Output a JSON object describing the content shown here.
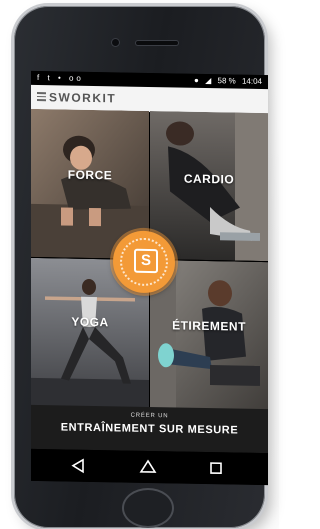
{
  "status_bar": {
    "left_icons": [
      "facebook-icon",
      "twitter-icon",
      "notification-icon",
      "voicemail-icon"
    ],
    "battery": "58 %",
    "time": "14:04"
  },
  "app": {
    "brand": "SWORKIT"
  },
  "tiles": [
    {
      "label": "FORCE"
    },
    {
      "label": "CARDIO"
    },
    {
      "label": "YOGA"
    },
    {
      "label": "ÉTIREMENT"
    }
  ],
  "badge": {
    "letter": "S"
  },
  "custom_workout": {
    "small": "CRÉER UN",
    "big": "ENTRAÎNEMENT SUR MESURE"
  },
  "colors": {
    "accent": "#f39a37",
    "custom_bar": "#1c1c1c"
  }
}
